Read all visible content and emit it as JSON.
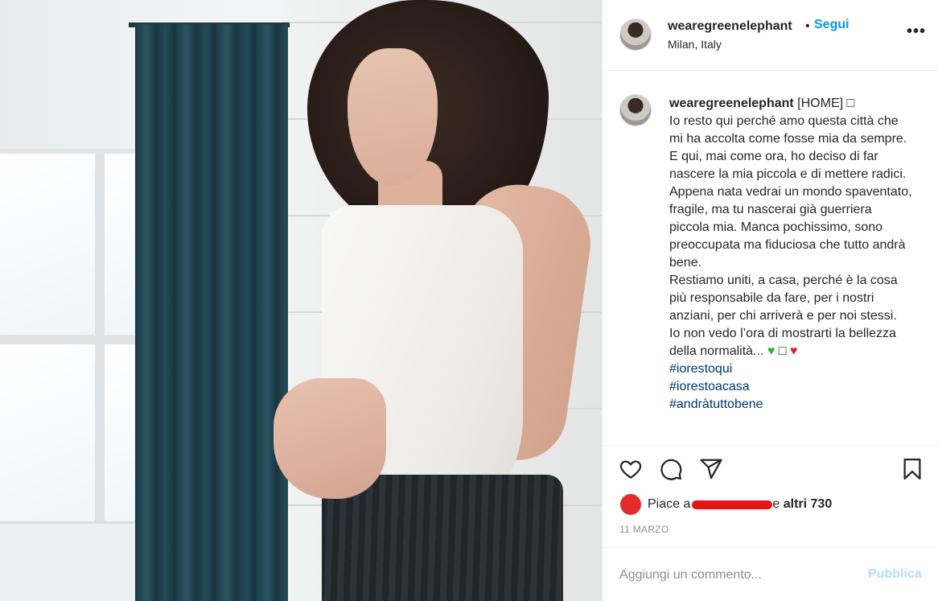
{
  "post": {
    "username": "wearegreenelephant",
    "dot": "•",
    "follow_label": "Segui",
    "location": "Milan, Italy",
    "more_label": "•••"
  },
  "caption": {
    "username": "wearegreenelephant",
    "text": " [HOME] □\nIo resto qui perché amo questa città che mi ha accolta come fosse mia da sempre. E qui, mai come ora, ho deciso di far nascere la mia piccola e di mettere radici.\nAppena nata vedrai un mondo spaventato, fragile, ma tu nascerai già guerriera piccola mia. Manca pochissimo, sono preoccupata ma fiduciosa che tutto andrà bene.\nRestiamo uniti, a casa, perché è la cosa più responsabile da fare, per i nostri anziani, per chi arriverà e per noi stessi.\nIo non vedo l’ora di mostrarti la bellezza della normalità... ",
    "emoji_green_heart": "♥",
    "emoji_box": " □ ",
    "emoji_red_heart": "♥",
    "hashtags": [
      "#iorestoqui",
      "#iorestoacasa",
      "#andràtuttobene"
    ]
  },
  "actions": {
    "like_icon": "heart-outline-icon",
    "comment_icon": "comment-bubble-icon",
    "share_icon": "paper-plane-icon",
    "save_icon": "bookmark-icon"
  },
  "likes": {
    "prefix": "Piace a",
    "suffix": "e",
    "others": "altri 730"
  },
  "date": "11 MARZO",
  "comment_box": {
    "placeholder": "Aggiungi un commento...",
    "post_label": "Pubblica"
  },
  "colors": {
    "link_blue": "#0095f6",
    "hashtag_blue": "#00376b",
    "post_disabled": "#b2dffc",
    "redaction_red": "#e8141a",
    "curtain_teal": "#1c3a45"
  }
}
